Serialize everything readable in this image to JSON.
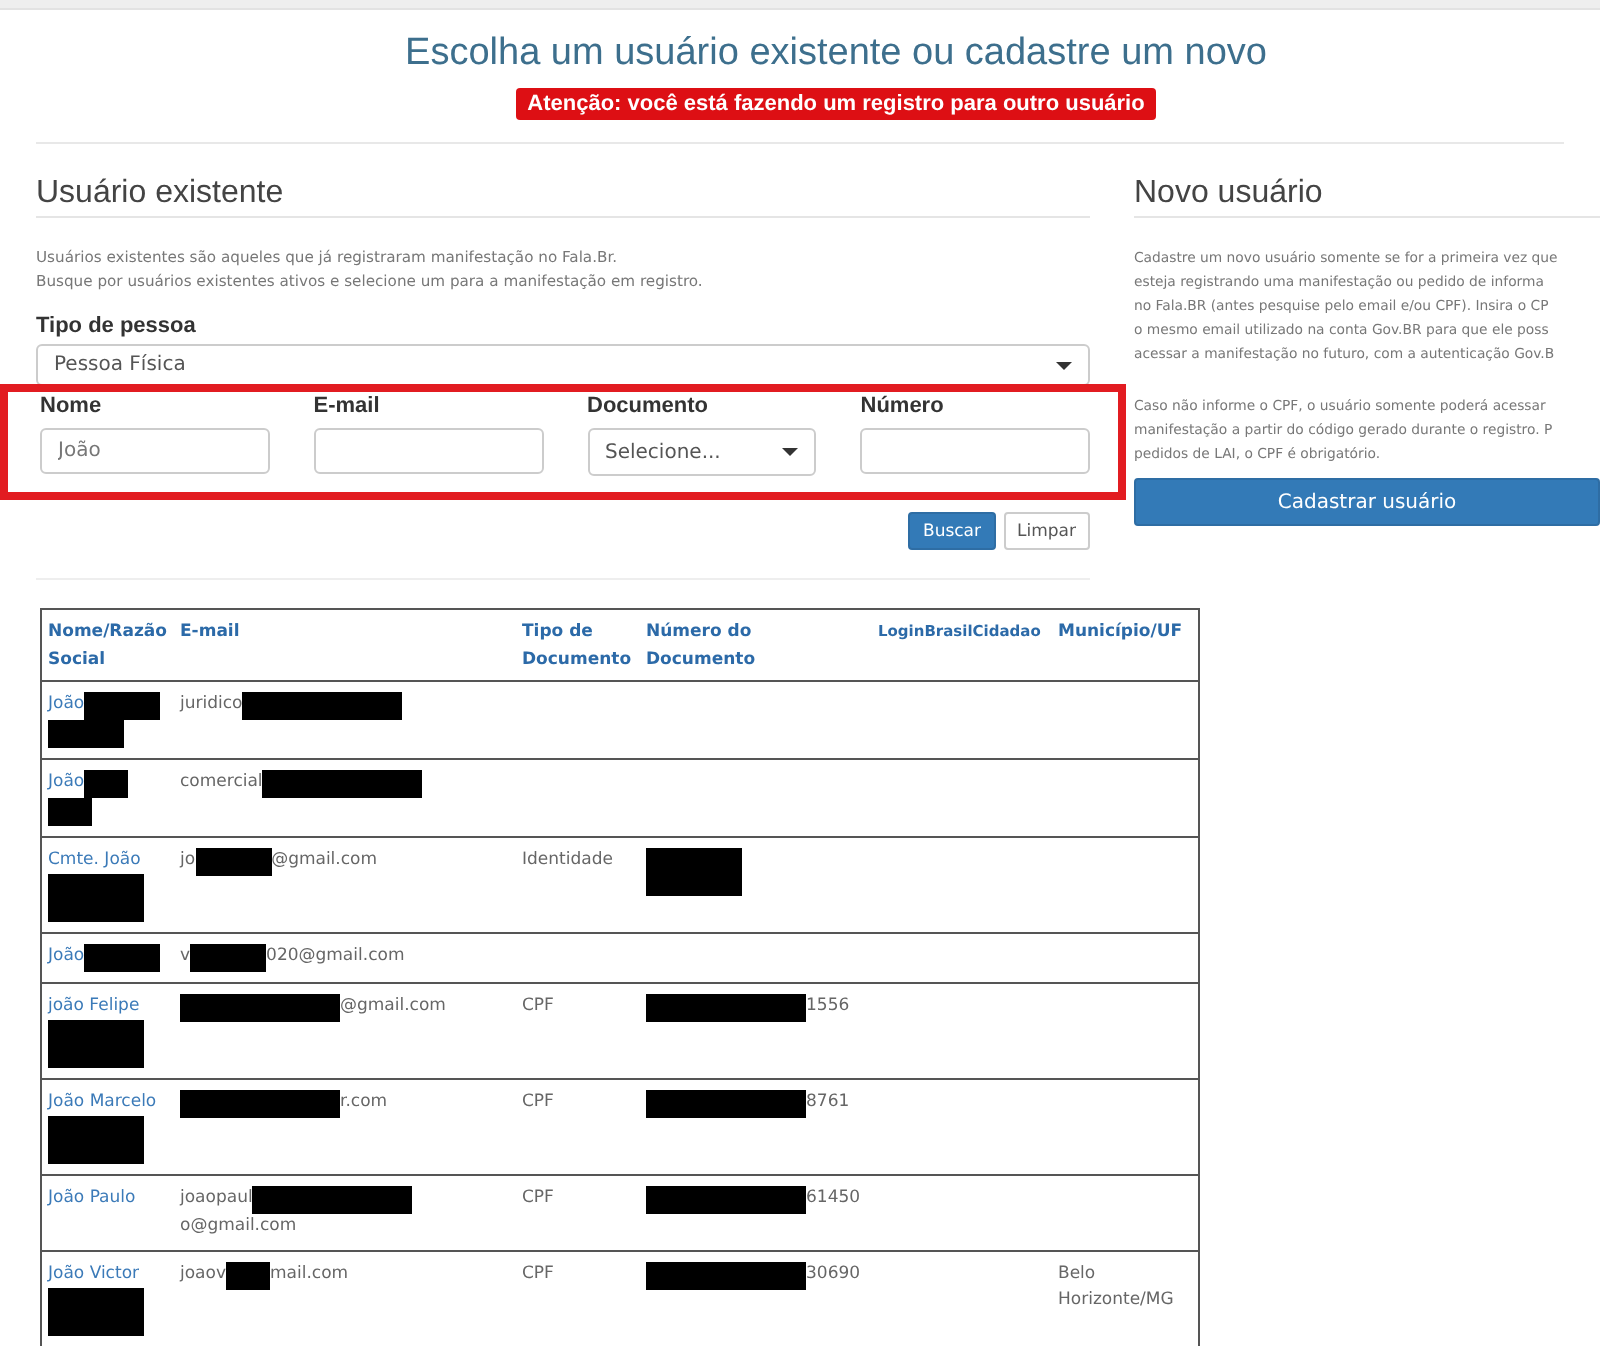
{
  "page_title": "Escolha um usuário existente ou cadastre um novo",
  "alert": "Atenção: você está fazendo um registro para outro usuário",
  "existing": {
    "heading": "Usuário existente",
    "description": [
      "Usuários existentes são aqueles que já registraram manifestação no Fala.Br.",
      "Busque por usuários existentes ativos e selecione um para a manifestação em registro."
    ],
    "person_type": {
      "label": "Tipo de pessoa",
      "value": "Pessoa Física"
    },
    "filters": [
      {
        "kind": "input",
        "label": "Nome",
        "value": "João"
      },
      {
        "kind": "input",
        "label": "E-mail"
      },
      {
        "kind": "select",
        "label": "Documento",
        "value": "Selecione..."
      },
      {
        "kind": "input",
        "label": "Número"
      }
    ],
    "buttons": [
      {
        "label": "Buscar",
        "kind": "primary"
      },
      {
        "label": "Limpar",
        "kind": "default"
      }
    ],
    "table": {
      "columns": [
        "Nome/Razão Social",
        "E-mail",
        "Tipo de Documento",
        "Número do Documento",
        "LoginBrasilCidadao",
        "Município/UF"
      ],
      "rows": [
        [
          [
            {
              "kind": "text",
              "text": "João"
            },
            {
              "kind": "redacted_medium"
            },
            {
              "kind": "redacted_medium"
            }
          ],
          [
            {
              "kind": "text",
              "text": "juridico"
            },
            {
              "kind": "redacted_long"
            }
          ],
          [],
          [],
          [],
          []
        ],
        [
          [
            {
              "kind": "text",
              "text": "João"
            },
            {
              "kind": "redacted_small"
            },
            {
              "kind": "redacted_small"
            }
          ],
          [
            {
              "kind": "text",
              "text": "comercial"
            },
            {
              "kind": "redacted_xlong"
            }
          ],
          [],
          [],
          [],
          []
        ],
        [
          [
            {
              "kind": "text",
              "text": "Cmte. João"
            },
            {
              "kind": "redacted_tall"
            }
          ],
          [
            {
              "kind": "text",
              "text": "jo"
            },
            {
              "kind": "redacted_medium"
            },
            {
              "kind": "text",
              "text": "@gmail.com"
            }
          ],
          [
            {
              "kind": "text",
              "text": "Identidade"
            }
          ],
          [
            {
              "kind": "redacted_tall"
            }
          ],
          [],
          []
        ],
        [
          [
            {
              "kind": "text",
              "text": "João"
            },
            {
              "kind": "redacted_medium"
            }
          ],
          [
            {
              "kind": "text",
              "text": "v"
            },
            {
              "kind": "redacted_medium"
            },
            {
              "kind": "text",
              "text": "020@gmail.com"
            }
          ],
          [],
          [],
          [],
          []
        ],
        [
          [
            {
              "kind": "text",
              "text": "joão Felipe"
            },
            {
              "kind": "redacted_tall"
            }
          ],
          [
            {
              "kind": "redacted_long"
            },
            {
              "kind": "text",
              "text": "@gmail.com"
            }
          ],
          [
            {
              "kind": "text",
              "text": "CPF"
            }
          ],
          [
            {
              "kind": "redacted_xlong"
            },
            {
              "kind": "text",
              "text": "1556"
            }
          ],
          [],
          []
        ],
        [
          [
            {
              "kind": "text",
              "text": "João Marcelo"
            },
            {
              "kind": "redacted_tall"
            }
          ],
          [
            {
              "kind": "redacted_long"
            },
            {
              "kind": "text",
              "text": "r.com"
            }
          ],
          [
            {
              "kind": "text",
              "text": "CPF"
            }
          ],
          [
            {
              "kind": "redacted_xlong"
            },
            {
              "kind": "text",
              "text": "8761"
            }
          ],
          [],
          []
        ],
        [
          [
            {
              "kind": "text",
              "text": "João Paulo"
            }
          ],
          [
            {
              "kind": "text",
              "text": "joaopaul"
            },
            {
              "kind": "redacted_long"
            },
            {
              "kind": "text",
              "text": "o@gmail.com"
            }
          ],
          [
            {
              "kind": "text",
              "text": "CPF"
            }
          ],
          [
            {
              "kind": "redacted_xlong"
            },
            {
              "kind": "text",
              "text": "61450"
            }
          ],
          [],
          []
        ],
        [
          [
            {
              "kind": "text",
              "text": "João Victor"
            },
            {
              "kind": "redacted_tall"
            }
          ],
          [
            {
              "kind": "text",
              "text": "joaov"
            },
            {
              "kind": "redacted_small"
            },
            {
              "kind": "text",
              "text": "mail.com"
            }
          ],
          [
            {
              "kind": "text",
              "text": "CPF"
            }
          ],
          [
            {
              "kind": "redacted_xlong"
            },
            {
              "kind": "text",
              "text": "30690"
            }
          ],
          [],
          [
            {
              "kind": "text",
              "text": "Belo Horizonte/MG"
            }
          ]
        ]
      ]
    }
  },
  "new_user": {
    "heading": "Novo usuário",
    "paragraphs": [
      [
        "Cadastre um novo usuário somente se for a primeira vez que",
        "esteja registrando uma manifestação ou pedido de informa",
        "no Fala.BR (antes pesquise pelo email e/ou CPF). Insira o CP",
        "o mesmo email utilizado na conta Gov.BR para que ele poss",
        "acessar a manifestação no futuro, com a autenticação Gov.B"
      ],
      [
        "Caso não informe o CPF, o usuário somente poderá acessar",
        "manifestação a partir do código gerado durante o registro. P",
        "pedidos de LAI, o CPF é obrigatório."
      ]
    ],
    "button": "Cadastrar usuário"
  }
}
